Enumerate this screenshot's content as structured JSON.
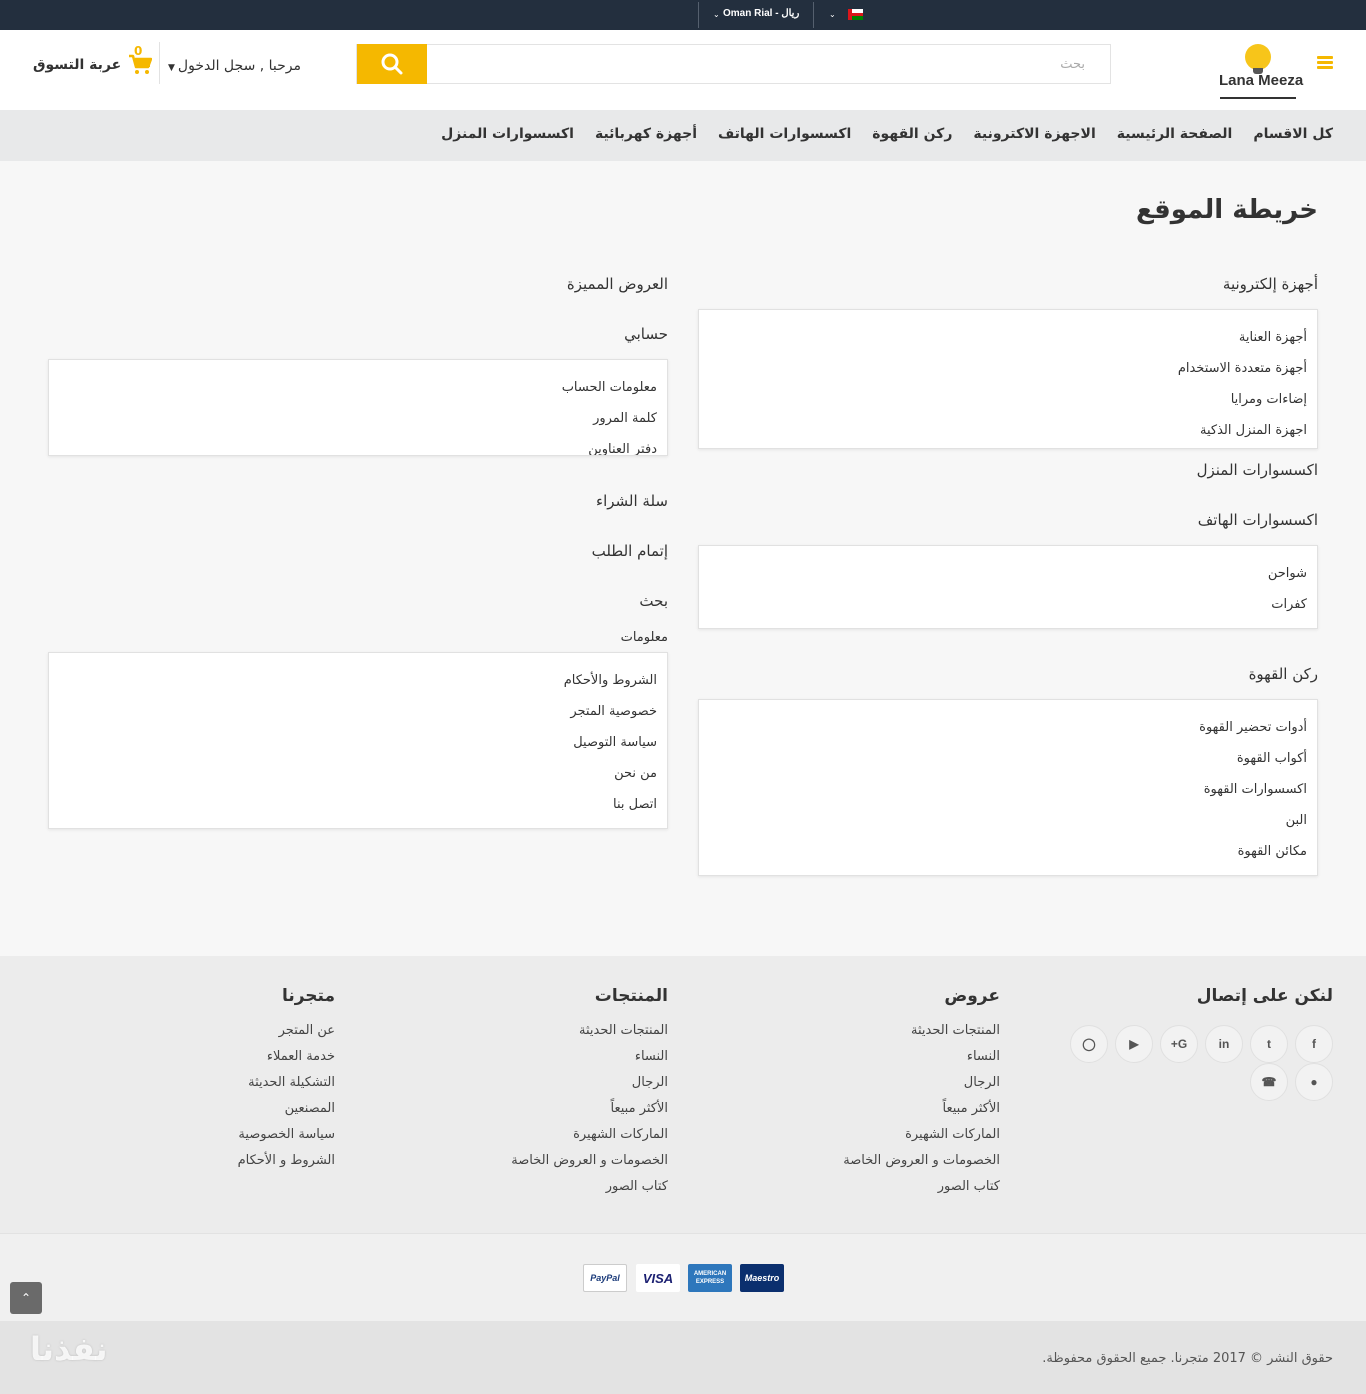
{
  "topbar": {
    "currency_label": "Oman Rial - ريال",
    "colors": {
      "background": "#232f3e"
    }
  },
  "header": {
    "logo_text": "Lana Meeza",
    "search": {
      "placeholder": "بحث"
    },
    "account_label": "مرحبا , سجل الدخول",
    "cart": {
      "count": "0",
      "label": "عربة التسوق"
    },
    "colors": {
      "accent": "#f5b800"
    }
  },
  "nav": {
    "items": [
      {
        "label": "كل الاقسام"
      },
      {
        "label": "الصفحة الرئيسية"
      },
      {
        "label": "الاجهزة الاكترونية"
      },
      {
        "label": "ركن القهوة"
      },
      {
        "label": "اكسسوارات الهاتف"
      },
      {
        "label": "أجهزة كهربائية"
      },
      {
        "label": "اكسسوارات المنزل"
      }
    ]
  },
  "page": {
    "title": "خريطة الموقع"
  },
  "sitemap": {
    "right": {
      "electronics": {
        "title": "أجهزة إلكترونية",
        "items": [
          "أجهزة العناية",
          "أجهزة متعددة الاستخدام",
          "إضاءات ومرايا",
          "اجهزة المنزل الذكية"
        ]
      },
      "home_accessories": {
        "title": "اكسسوارات المنزل"
      },
      "phone_accessories": {
        "title": "اكسسوارات الهاتف",
        "items": [
          "شواحن",
          "كفرات"
        ]
      },
      "coffee": {
        "title": "ركن القهوة",
        "items": [
          "أدوات تحضير القهوة",
          "أكواب القهوة",
          "اكسسوارات القهوة",
          "البن",
          "مكائن القهوة"
        ]
      }
    },
    "left": {
      "featured": {
        "title": "العروض المميزة"
      },
      "account": {
        "title": "حسابي",
        "items": [
          "معلومات الحساب",
          "كلمة المرور",
          "دفتر العناوين"
        ]
      },
      "cart": {
        "title": "سلة الشراء"
      },
      "checkout": {
        "title": "إتمام الطلب"
      },
      "search": {
        "title": "بحث"
      },
      "info": {
        "title": "معلومات",
        "items": [
          "الشروط والأحكام",
          "خصوصية المتجر",
          "سياسة التوصيل",
          "من نحن",
          "اتصل بنا"
        ]
      }
    }
  },
  "footer": {
    "contact": {
      "title": "لنكن على إتصال",
      "social": [
        "facebook-icon",
        "twitter-icon",
        "linkedin-icon",
        "google-plus-icon",
        "youtube-icon",
        "instagram-icon",
        "snapchat-icon",
        "whatsapp-icon"
      ]
    },
    "offers": {
      "title": "عروض",
      "items": [
        "المنتجات الحديثة",
        "النساء",
        "الرجال",
        "الأكثر مبيعاً",
        "الماركات الشهيرة",
        "الخصومات و العروض الخاصة",
        "كتاب الصور"
      ]
    },
    "products": {
      "title": "المنتجات",
      "items": [
        "المنتجات الحديثة",
        "النساء",
        "الرجال",
        "الأكثر مبيعاً",
        "الماركات الشهيرة",
        "الخصومات و العروض الخاصة",
        "كتاب الصور"
      ]
    },
    "store": {
      "title": "متجرنا",
      "items": [
        "عن المتجر",
        "خدمة العملاء",
        "التشكيلة الحديثة",
        "المصنعين",
        "سياسة الخصوصية",
        "الشروط و الأحكام"
      ]
    },
    "payments": [
      "PayPal",
      "VISA",
      "AMERICAN EXPRESS",
      "Maestro"
    ],
    "copyright": "حقوق النشر © 2017 متجرنا. جميع الحقوق محفوظة."
  },
  "watermark": {
    "text": "نفذنا"
  }
}
